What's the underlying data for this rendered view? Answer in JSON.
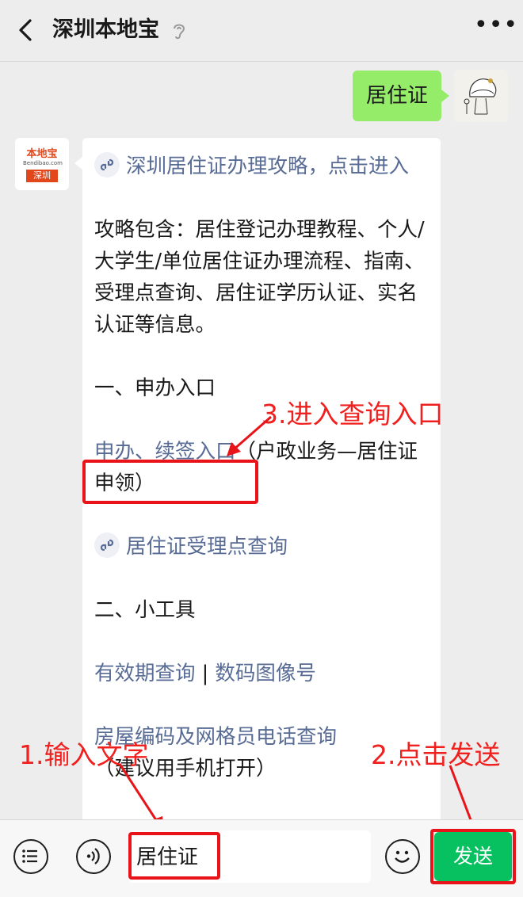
{
  "header": {
    "title": "深圳本地宝",
    "back_icon": "chevron-left-icon",
    "ear_icon": "ear-icon",
    "more_label": "•••"
  },
  "user_message": {
    "text": "居住证"
  },
  "bot_avatar": {
    "logo_text": "本地宝",
    "logo_sub": "Bendibao.com",
    "city": "深圳"
  },
  "reply": {
    "guide_link": "深圳居住证办理攻略，点击进入",
    "intro": "攻略包含：居住登记办理教程、个人/大学生/单位居住证办理流程、指南、受理点查询、居住证学历认证、实名认证等信息。",
    "section1": "一、申办入口",
    "apply_link": "申办、续签入口",
    "apply_note": "（户政业务—居住证申领）",
    "service_point_link": "居住证受理点查询",
    "section2": "二、小工具",
    "tool_link_1": "有效期查询",
    "tool_separator": " | ",
    "tool_link_2": "数码图像号",
    "tool_link_3": "房屋编码及网格员电话查询",
    "tool_note": "（建议用手机打开）"
  },
  "annotations": {
    "step1": "1.输入文字",
    "step2": "2.点击发送",
    "step3": "3.进入查询入口"
  },
  "input": {
    "value": "居住证"
  },
  "send_button": {
    "label": "发送"
  },
  "colors": {
    "accent_green": "#07c160",
    "bubble_green": "#95ec69",
    "link_blue": "#576b95",
    "annotation_red": "#e8141a"
  }
}
